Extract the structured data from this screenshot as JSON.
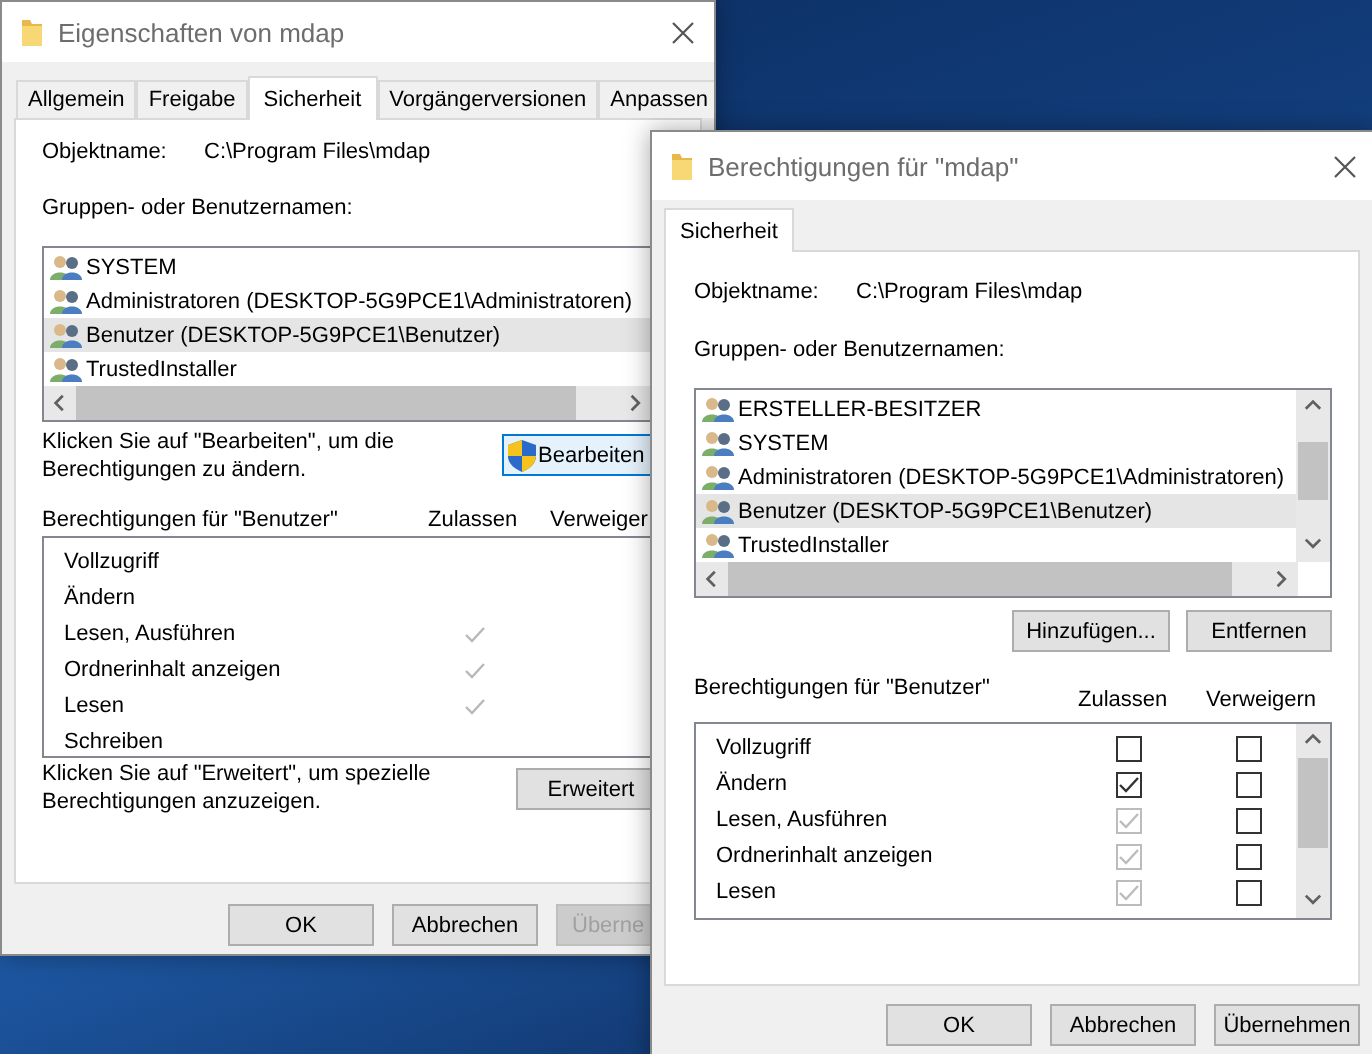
{
  "back_window": {
    "title": "Eigenschaften von mdap",
    "tabs": [
      {
        "label": "Allgemein",
        "selected": false
      },
      {
        "label": "Freigabe",
        "selected": false
      },
      {
        "label": "Sicherheit",
        "selected": true
      },
      {
        "label": "Vorgängerversionen",
        "selected": false
      },
      {
        "label": "Anpassen",
        "selected": false
      }
    ],
    "object_label": "Objektname:",
    "object_value": "C:\\Program Files\\mdap",
    "groups_label": "Gruppen- oder Benutzernamen:",
    "users": [
      {
        "name": "SYSTEM",
        "selected": false
      },
      {
        "name": "Administratoren (DESKTOP-5G9PCE1\\Administratoren)",
        "selected": false
      },
      {
        "name": "Benutzer (DESKTOP-5G9PCE1\\Benutzer)",
        "selected": true
      },
      {
        "name": "TrustedInstaller",
        "selected": false
      }
    ],
    "edit_hint": "Klicken Sie auf \"Bearbeiten\", um die Berechtigungen zu ändern.",
    "edit_button": "Bearbeiten",
    "permissions_label": "Berechtigungen für \"Benutzer\"",
    "column_allow": "Zulassen",
    "column_deny": "Verweiger",
    "permissions": [
      {
        "name": "Vollzugriff",
        "allow_checked": false
      },
      {
        "name": "Ändern",
        "allow_checked": false
      },
      {
        "name": "Lesen, Ausführen",
        "allow_checked": true
      },
      {
        "name": "Ordnerinhalt anzeigen",
        "allow_checked": true
      },
      {
        "name": "Lesen",
        "allow_checked": true
      },
      {
        "name": "Schreiben",
        "allow_checked": false
      }
    ],
    "advanced_hint": "Klicken Sie auf \"Erweitert\", um spezielle Berechtigungen anzuzeigen.",
    "advanced_button": "Erweitert",
    "buttons": [
      {
        "label": "OK",
        "disabled": false
      },
      {
        "label": "Abbrechen",
        "disabled": false
      },
      {
        "label": "Überne",
        "disabled": true
      }
    ]
  },
  "front_window": {
    "title": "Berechtigungen für \"mdap\"",
    "tabs": [
      {
        "label": "Sicherheit",
        "selected": true
      }
    ],
    "object_label": "Objektname:",
    "object_value": "C:\\Program Files\\mdap",
    "groups_label": "Gruppen- oder Benutzernamen:",
    "users": [
      {
        "name": "ERSTELLER-BESITZER",
        "selected": false
      },
      {
        "name": "SYSTEM",
        "selected": false
      },
      {
        "name": "Administratoren (DESKTOP-5G9PCE1\\Administratoren)",
        "selected": false
      },
      {
        "name": "Benutzer (DESKTOP-5G9PCE1\\Benutzer)",
        "selected": true
      },
      {
        "name": "TrustedInstaller",
        "selected": false
      }
    ],
    "add_button": "Hinzufügen...",
    "remove_button": "Entfernen",
    "permissions_label": "Berechtigungen für \"Benutzer\"",
    "column_allow": "Zulassen",
    "column_deny": "Verweigern",
    "permissions": [
      {
        "name": "Vollzugriff",
        "allow_checked": false,
        "allow_disabled": false,
        "deny_checked": false
      },
      {
        "name": "Ändern",
        "allow_checked": true,
        "allow_disabled": false,
        "deny_checked": false
      },
      {
        "name": "Lesen, Ausführen",
        "allow_checked": true,
        "allow_disabled": true,
        "deny_checked": false
      },
      {
        "name": "Ordnerinhalt anzeigen",
        "allow_checked": true,
        "allow_disabled": true,
        "deny_checked": false
      },
      {
        "name": "Lesen",
        "allow_checked": true,
        "allow_disabled": true,
        "deny_checked": false
      }
    ],
    "buttons": [
      {
        "label": "OK",
        "disabled": false
      },
      {
        "label": "Abbrechen",
        "disabled": false
      },
      {
        "label": "Übernehmen",
        "disabled": false
      }
    ]
  }
}
